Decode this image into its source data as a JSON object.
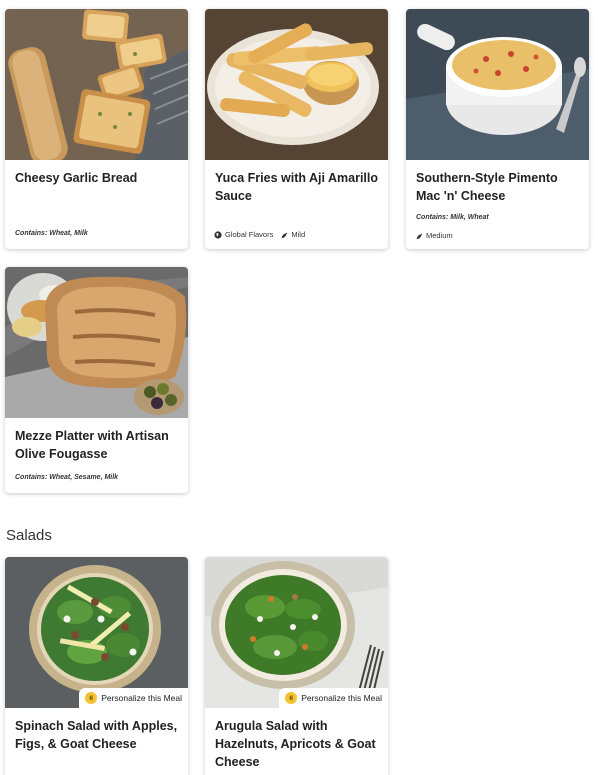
{
  "cards_top": [
    {
      "title": "Cheesy Garlic Bread",
      "contains": "Contains: Wheat, Milk",
      "tags": []
    },
    {
      "title": "Yuca Fries with Aji Amarillo Sauce",
      "contains": "",
      "tags": [
        {
          "icon": "globe-icon",
          "label": "Global Flavors"
        },
        {
          "icon": "pepper-icon",
          "label": "Mild"
        }
      ]
    },
    {
      "title": "Southern-Style Pimento Mac 'n' Cheese",
      "contains": "Contains: Milk, Wheat",
      "tags": [
        {
          "icon": "pepper-icon",
          "label": "Medium"
        }
      ]
    },
    {
      "title": "Mezze Platter with Artisan Olive Fougasse",
      "contains": "Contains: Wheat, Sesame, Milk",
      "tags": []
    }
  ],
  "salads_section": {
    "heading": "Salads",
    "cards": [
      {
        "title": "Spinach Salad with Apples, Figs, & Goat Cheese",
        "badge_number": "6",
        "badge_label": "Personalize this Meal"
      },
      {
        "title": "Arugula Salad with Hazelnuts, Apricots & Goat Cheese",
        "badge_number": "6",
        "badge_label": "Personalize this Meal"
      }
    ]
  },
  "colors": {
    "badge_coin": "#f2c230",
    "card_shadow": "rgba(0,0,0,0.22)"
  }
}
